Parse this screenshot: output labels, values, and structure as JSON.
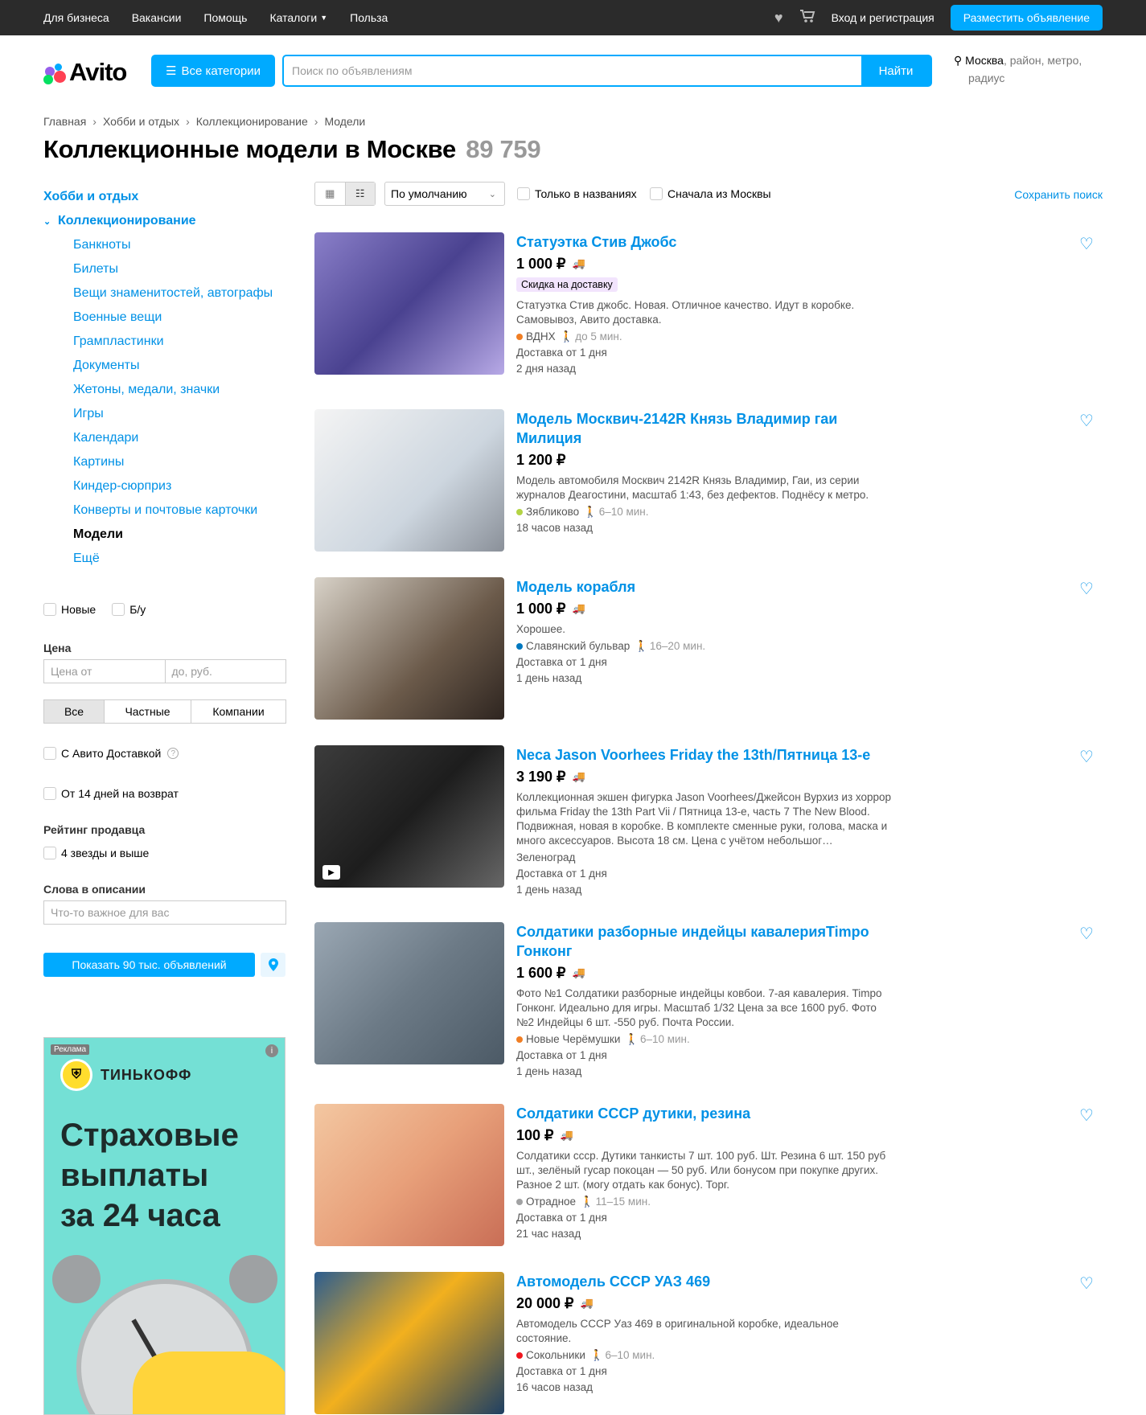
{
  "topbar": {
    "nav": [
      "Для бизнеса",
      "Вакансии",
      "Помощь",
      "Каталоги",
      "Польза"
    ],
    "login": "Вход и регистрация",
    "post_button": "Разместить объявление"
  },
  "header": {
    "logo_text": "Avito",
    "all_categories": "Все категории",
    "search_placeholder": "Поиск по объявлениям",
    "search_button": "Найти",
    "location_city": "Москва",
    "location_rest": ", район, метро,",
    "location_rest2": "радиус"
  },
  "breadcrumbs": [
    "Главная",
    "Хобби и отдых",
    "Коллекционирование",
    "Модели"
  ],
  "page": {
    "title": "Коллекционные модели в Москве",
    "count": "89 759"
  },
  "sidebar": {
    "top_category": "Хобби и отдых",
    "sub_category": "Коллекционирование",
    "items": [
      "Банкноты",
      "Билеты",
      "Вещи знаменитостей, автографы",
      "Военные вещи",
      "Грампластинки",
      "Документы",
      "Жетоны, медали, значки",
      "Игры",
      "Календари",
      "Картины",
      "Киндер-сюрприз",
      "Конверты и почтовые карточки",
      "Модели",
      "Ещё"
    ],
    "current": "Модели"
  },
  "filters": {
    "cond_new": "Новые",
    "cond_used": "Б/у",
    "price_label": "Цена",
    "price_from": "Цена от",
    "price_to": "до, руб.",
    "seller_types": [
      "Все",
      "Частные",
      "Компании"
    ],
    "delivery": "С Авито Доставкой",
    "return": "От 14 дней на возврат",
    "rating_label": "Рейтинг продавца",
    "rating_opt": "4 звезды и выше",
    "words_label": "Слова в описании",
    "words_placeholder": "Что-то важное для вас",
    "show_button": "Показать 90 тыс. объявлений"
  },
  "ad": {
    "tag": "Реклама",
    "brand": "ТИНЬКОФФ",
    "slogan_1": "Страховые",
    "slogan_2": "выплаты",
    "slogan_3": "за 24 часа"
  },
  "toolbar": {
    "sort": "По умолчанию",
    "only_titles": "Только в названиях",
    "moscow_first": "Сначала из Москвы",
    "save_search": "Сохранить поиск"
  },
  "listings": [
    {
      "title": "Статуэтка Стив Джобс",
      "price": "1 000 ₽",
      "badge": "Скидка на доставку",
      "desc": "Статуэтка Стив джобс. Новая. Отличное качество. Идут в коробке. Самовывоз, Авито доставка.",
      "metro": "ВДНХ",
      "metro_color": "#f07e24",
      "walk": "до 5 мин.",
      "delivery": "Доставка от 1 дня",
      "date": "2 дня назад"
    },
    {
      "title": "Модель Москвич-2142R Князь Владимир гаи Милиция",
      "price": "1 200 ₽",
      "badge": "",
      "desc": "Модель автомобиля Москвич 2142R Князь Владимир, Гаи, из серии журналов Деагостини, масштаб 1:43, без дефектов. Поднёсу к метро.",
      "metro": "Зябликово",
      "metro_color": "#b4d445",
      "walk": "6–10 мин.",
      "delivery": "",
      "date": "18 часов назад"
    },
    {
      "title": "Модель корабля",
      "price": "1 000 ₽",
      "badge": "",
      "desc": "Хорошее.",
      "metro": "Славянский бульвар",
      "metro_color": "#0078bf",
      "walk": "16–20 мин.",
      "delivery": "Доставка от 1 дня",
      "date": "1 день назад"
    },
    {
      "title": "Neca Jason Voorhees Friday the 13th/Пятница 13-е",
      "price": "3 190 ₽",
      "badge": "",
      "desc": "Коллекционная экшен фигурка Jason Voorhees/Джейсон Вурхиз из хоррор фильма Friday the 13th Part Vii / Пятница 13-е, часть 7 The New Blood. Подвижная, новая в коробке. В комплекте сменные руки, голова, маска и много аксессуаров. Высота 18 см. Цена с учётом небольшог…",
      "metro": "Зеленоград",
      "metro_color": "",
      "walk": "",
      "delivery": "Доставка от 1 дня",
      "date": "1 день назад"
    },
    {
      "title": "Солдатики разборные индейцы кавалерияTimpo Гонконг",
      "price": "1 600 ₽",
      "badge": "",
      "desc": "Фото №1 Солдатики разборные индейцы ковбои. 7-ая кавалерия. Timpo Гонконг. Идеально для игры. Масштаб 1/32 Цена за все 1600 руб. Фото №2 Индейцы 6 шт. -550 руб. Почта России.",
      "metro": "Новые Черёмушки",
      "metro_color": "#f07e24",
      "walk": "6–10 мин.",
      "delivery": "Доставка от 1 дня",
      "date": "1 день назад"
    },
    {
      "title": "Солдатики СССР дутики, резина",
      "price": "100 ₽",
      "badge": "",
      "desc": "Солдатики ссср. Дутики танкисты 7 шт. 100 руб. Шт. Резина 6 шт. 150 руб шт., зелёный гусар покоцан — 50 руб. Или бонусом при покупке других. Разное 2 шт. (могу отдать как бонус). Торг.",
      "metro": "Отрадное",
      "metro_color": "#a1a2a3",
      "walk": "11–15 мин.",
      "delivery": "Доставка от 1 дня",
      "date": "21 час назад"
    },
    {
      "title": "Автомодель СССР УАЗ 469",
      "price": "20 000 ₽",
      "badge": "",
      "desc": "Автомодель СССР Уаз 469 в оригинальной коробке, идеальное состояние.",
      "metro": "Сокольники",
      "metro_color": "#ef161e",
      "walk": "6–10 мин.",
      "delivery": "Доставка от 1 дня",
      "date": "16 часов назад"
    }
  ]
}
